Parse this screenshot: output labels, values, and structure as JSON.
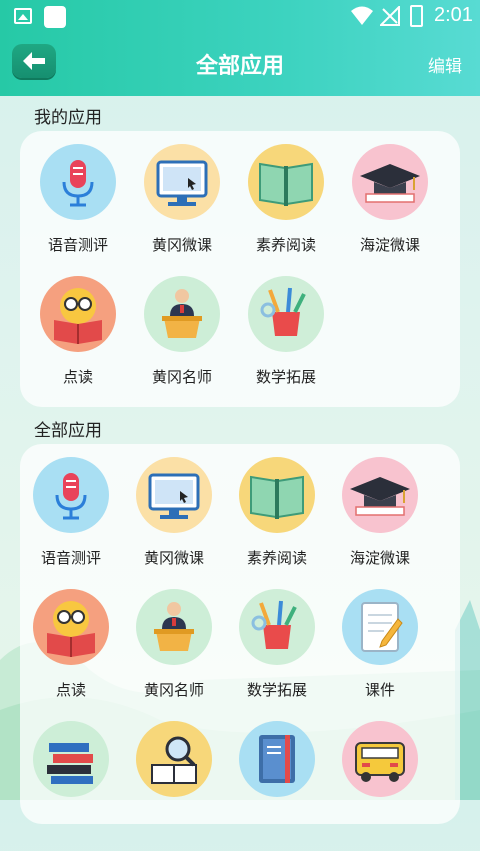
{
  "status_bar": {
    "time": "2:01"
  },
  "header": {
    "title": "全部应用",
    "edit_label": "编辑"
  },
  "my_apps": {
    "title": "我的应用",
    "items": [
      {
        "label": "语音测评",
        "icon": "microphone-icon",
        "color": "#a9dff3"
      },
      {
        "label": "黄冈微课",
        "icon": "monitor-icon",
        "color": "#fbe0a6"
      },
      {
        "label": "素养阅读",
        "icon": "open-book-icon",
        "color": "#f7d77a"
      },
      {
        "label": "海淀微课",
        "icon": "graduation-cap-icon",
        "color": "#f8c3cf"
      },
      {
        "label": "点读",
        "icon": "reading-emoji-icon",
        "color": "#f5a07f"
      },
      {
        "label": "黄冈名师",
        "icon": "teacher-podium-icon",
        "color": "#cdeed7"
      },
      {
        "label": "数学拓展",
        "icon": "pencil-cup-icon",
        "color": "#cfeed8"
      }
    ]
  },
  "all_apps": {
    "title": "全部应用",
    "items": [
      {
        "label": "语音测评",
        "icon": "microphone-icon",
        "color": "#a9dff3"
      },
      {
        "label": "黄冈微课",
        "icon": "monitor-icon",
        "color": "#fbe0a6"
      },
      {
        "label": "素养阅读",
        "icon": "open-book-icon",
        "color": "#f7d77a"
      },
      {
        "label": "海淀微课",
        "icon": "graduation-cap-icon",
        "color": "#f8c3cf"
      },
      {
        "label": "点读",
        "icon": "reading-emoji-icon",
        "color": "#f5a07f"
      },
      {
        "label": "黄冈名师",
        "icon": "teacher-podium-icon",
        "color": "#cdeed7"
      },
      {
        "label": "数学拓展",
        "icon": "pencil-cup-icon",
        "color": "#cfeed8"
      },
      {
        "label": "课件",
        "icon": "notepad-icon",
        "color": "#a9dff3"
      },
      {
        "label": "",
        "icon": "book-stack-icon",
        "color": "#cdeed7"
      },
      {
        "label": "",
        "icon": "book-magnifier-icon",
        "color": "#f7d77a"
      },
      {
        "label": "",
        "icon": "notebook-icon",
        "color": "#a9dff3"
      },
      {
        "label": "",
        "icon": "school-bus-icon",
        "color": "#f8c3cf"
      }
    ]
  }
}
